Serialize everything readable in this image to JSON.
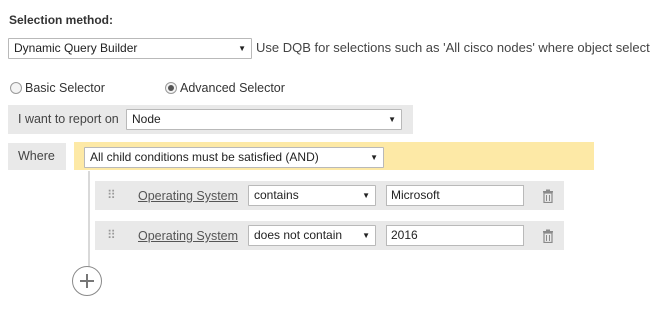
{
  "selection": {
    "heading": "Selection method:",
    "method_value": "Dynamic Query Builder",
    "hint": "Use DQB for selections such as 'All cisco nodes' where object select"
  },
  "selector_mode": {
    "basic_label": "Basic Selector",
    "advanced_label": "Advanced Selector",
    "selected": "Advanced Selector"
  },
  "report_on": {
    "label": "I want to report on",
    "value": "Node"
  },
  "where": {
    "label": "Where",
    "group_value": "All child conditions must be satisfied (AND)",
    "conditions": [
      {
        "field": "Operating System",
        "operator": "contains",
        "value": "Microsoft"
      },
      {
        "field": "Operating System",
        "operator": "does not contain",
        "value": "2016"
      }
    ]
  },
  "icons": {
    "caret": "▼",
    "drag": "⠿"
  }
}
